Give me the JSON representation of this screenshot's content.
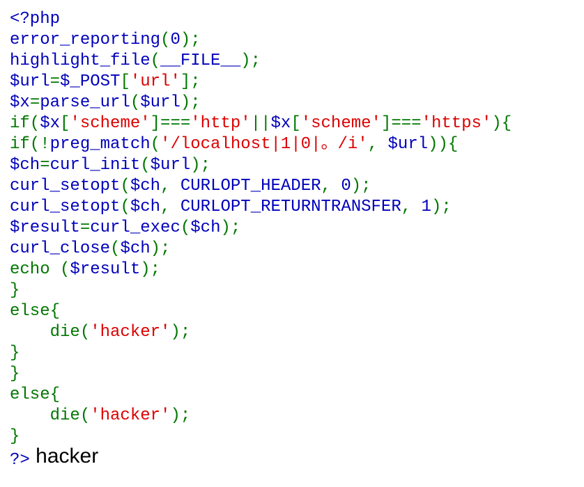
{
  "colors": {
    "html": "#000000",
    "default": "#0000BB",
    "keyword": "#007700",
    "string": "#DD0000"
  },
  "code_lines": [
    [
      [
        "default",
        "<?php"
      ]
    ],
    [
      [
        "default",
        "error_reporting"
      ],
      [
        "keyword",
        "("
      ],
      [
        "default",
        "0"
      ],
      [
        "keyword",
        ");"
      ]
    ],
    [
      [
        "default",
        "highlight_file"
      ],
      [
        "keyword",
        "("
      ],
      [
        "default",
        "__FILE__"
      ],
      [
        "keyword",
        ");"
      ]
    ],
    [
      [
        "default",
        "$url"
      ],
      [
        "keyword",
        "="
      ],
      [
        "default",
        "$_POST"
      ],
      [
        "keyword",
        "["
      ],
      [
        "string",
        "'url'"
      ],
      [
        "keyword",
        "];"
      ]
    ],
    [
      [
        "default",
        "$x"
      ],
      [
        "keyword",
        "="
      ],
      [
        "default",
        "parse_url"
      ],
      [
        "keyword",
        "("
      ],
      [
        "default",
        "$url"
      ],
      [
        "keyword",
        ");"
      ]
    ],
    [
      [
        "keyword",
        "if("
      ],
      [
        "default",
        "$x"
      ],
      [
        "keyword",
        "["
      ],
      [
        "string",
        "'scheme'"
      ],
      [
        "keyword",
        "]==="
      ],
      [
        "string",
        "'http'"
      ],
      [
        "keyword",
        "||"
      ],
      [
        "default",
        "$x"
      ],
      [
        "keyword",
        "["
      ],
      [
        "string",
        "'scheme'"
      ],
      [
        "keyword",
        "]==="
      ],
      [
        "string",
        "'https'"
      ],
      [
        "keyword",
        "){"
      ]
    ],
    [
      [
        "keyword",
        "if(!"
      ],
      [
        "default",
        "preg_match"
      ],
      [
        "keyword",
        "("
      ],
      [
        "string",
        "'/localhost|1|0|。/i'"
      ],
      [
        "keyword",
        ", "
      ],
      [
        "default",
        "$url"
      ],
      [
        "keyword",
        ")){"
      ]
    ],
    [
      [
        "default",
        "$ch"
      ],
      [
        "keyword",
        "="
      ],
      [
        "default",
        "curl_init"
      ],
      [
        "keyword",
        "("
      ],
      [
        "default",
        "$url"
      ],
      [
        "keyword",
        ");"
      ]
    ],
    [
      [
        "default",
        "curl_setopt"
      ],
      [
        "keyword",
        "("
      ],
      [
        "default",
        "$ch"
      ],
      [
        "keyword",
        ", "
      ],
      [
        "default",
        "CURLOPT_HEADER"
      ],
      [
        "keyword",
        ", "
      ],
      [
        "default",
        "0"
      ],
      [
        "keyword",
        ");"
      ]
    ],
    [
      [
        "default",
        "curl_setopt"
      ],
      [
        "keyword",
        "("
      ],
      [
        "default",
        "$ch"
      ],
      [
        "keyword",
        ", "
      ],
      [
        "default",
        "CURLOPT_RETURNTRANSFER"
      ],
      [
        "keyword",
        ", "
      ],
      [
        "default",
        "1"
      ],
      [
        "keyword",
        ");"
      ]
    ],
    [
      [
        "default",
        "$result"
      ],
      [
        "keyword",
        "="
      ],
      [
        "default",
        "curl_exec"
      ],
      [
        "keyword",
        "("
      ],
      [
        "default",
        "$ch"
      ],
      [
        "keyword",
        ");"
      ]
    ],
    [
      [
        "default",
        "curl_close"
      ],
      [
        "keyword",
        "("
      ],
      [
        "default",
        "$ch"
      ],
      [
        "keyword",
        ");"
      ]
    ],
    [
      [
        "keyword",
        "echo ("
      ],
      [
        "default",
        "$result"
      ],
      [
        "keyword",
        ");"
      ]
    ],
    [
      [
        "keyword",
        "}"
      ]
    ],
    [
      [
        "keyword",
        "else{"
      ]
    ],
    [
      [
        "keyword",
        "    die("
      ],
      [
        "string",
        "'hacker'"
      ],
      [
        "keyword",
        ");"
      ]
    ],
    [
      [
        "keyword",
        "}"
      ]
    ],
    [
      [
        "keyword",
        "}"
      ]
    ],
    [
      [
        "keyword",
        "else{"
      ]
    ],
    [
      [
        "keyword",
        "    die("
      ],
      [
        "string",
        "'hacker'"
      ],
      [
        "keyword",
        ");"
      ]
    ],
    [
      [
        "keyword",
        "}"
      ]
    ],
    [
      [
        "default",
        "?>"
      ]
    ]
  ],
  "output": {
    "text": " hacker"
  }
}
